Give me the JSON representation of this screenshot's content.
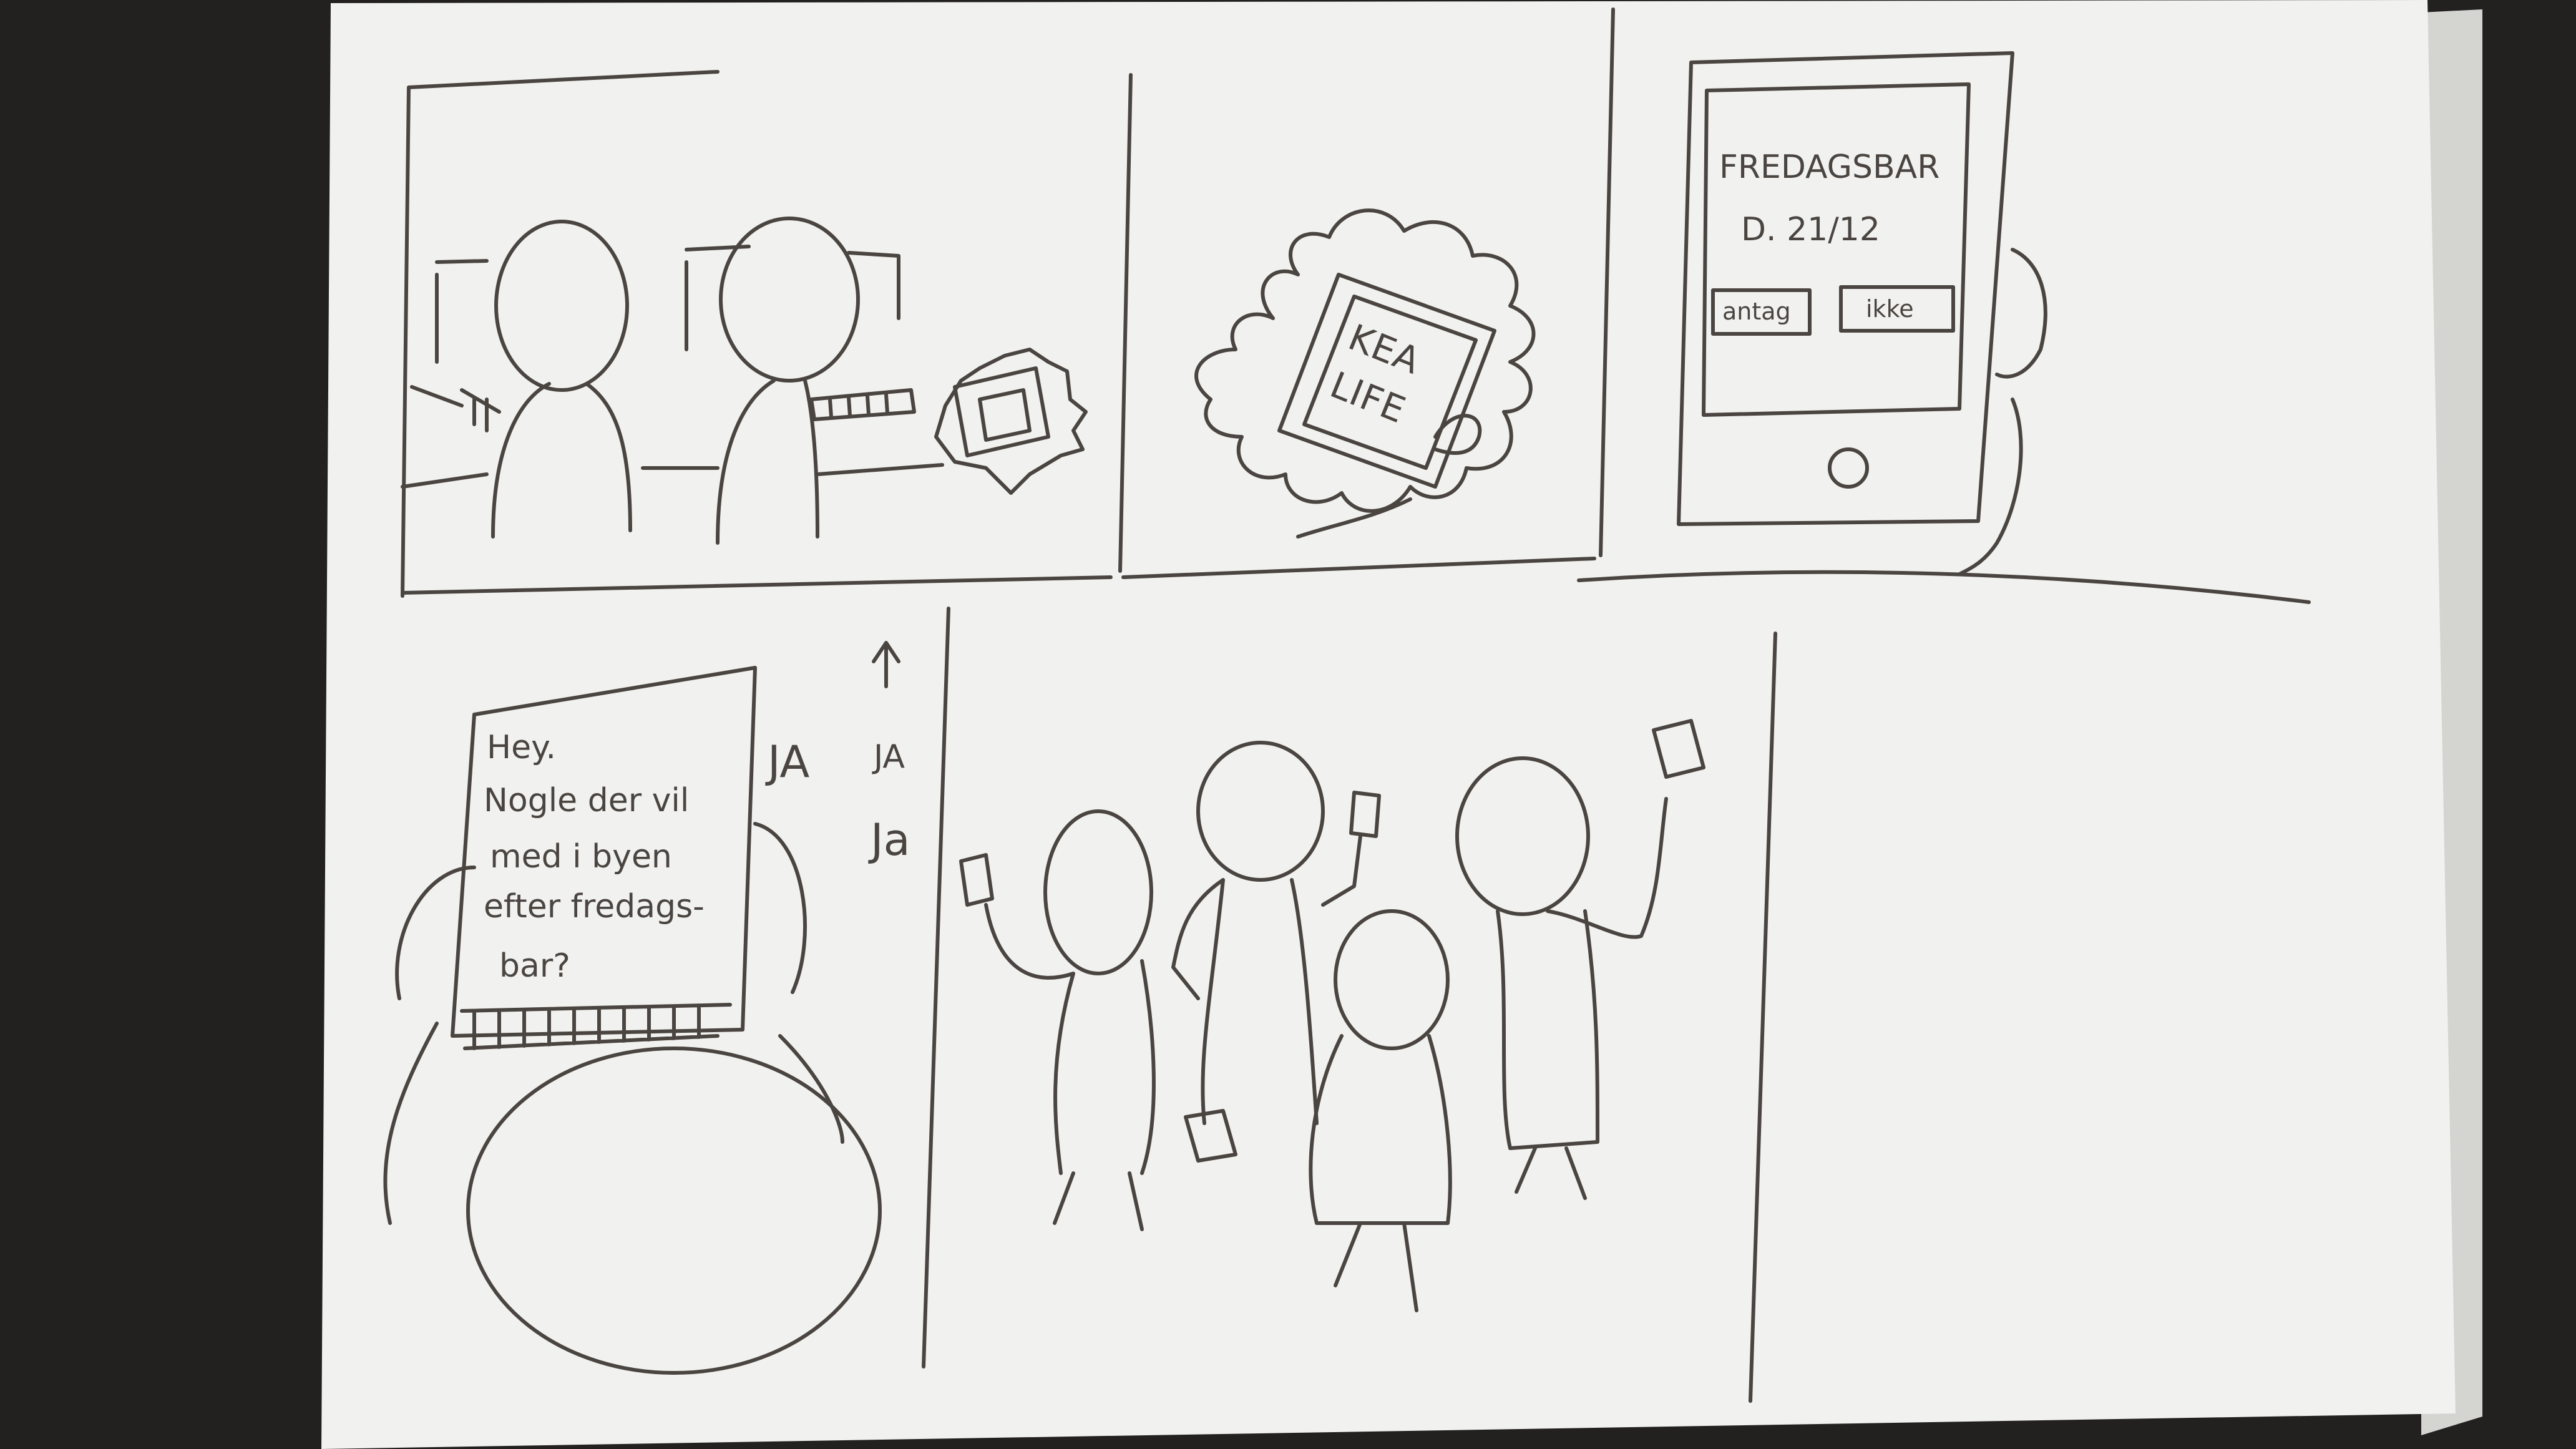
{
  "colors": {
    "background": "#222120",
    "paper": "#f1f1ef",
    "paper_shadow": "#d9d9d6",
    "pencil": "#4a4540"
  },
  "panel_2": {
    "tablet_text_line1": "KEA",
    "tablet_text_line2": "LIFE"
  },
  "panel_3": {
    "event_title": "FREDAGSBAR",
    "event_date": "D. 21/12",
    "accept_button": "antag",
    "decline_button": "ikke"
  },
  "panel_4": {
    "message_lines": [
      "Hey.",
      "Nogle der vil",
      "med i byen",
      "efter fredags-",
      "bar?"
    ],
    "reply_ja_1": "JA",
    "reply_ja_2": "JA",
    "reply_ja_3": "Ja",
    "arrow_mark": "M"
  }
}
